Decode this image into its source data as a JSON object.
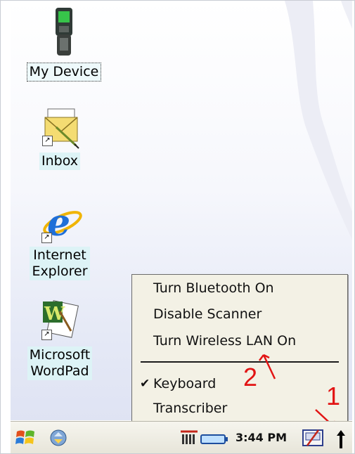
{
  "desktop": {
    "icons": [
      {
        "label": "My Device",
        "icon": "device-icon"
      },
      {
        "label": "Inbox",
        "icon": "inbox-icon"
      },
      {
        "label_line1": "Internet",
        "label_line2": "Explorer",
        "icon": "internet-explorer-icon"
      },
      {
        "label_line1": "Microsoft",
        "label_line2": "WordPad",
        "icon": "wordpad-icon"
      }
    ]
  },
  "popup_menu": {
    "items": [
      {
        "label": "Turn Bluetooth On"
      },
      {
        "label": "Disable Scanner"
      },
      {
        "label": "Turn Wireless LAN On"
      },
      {
        "label": "Keyboard",
        "checked": true
      },
      {
        "label": "Transcriber"
      }
    ]
  },
  "taskbar": {
    "time": "3:44 PM",
    "icons": [
      "start-icon",
      "activesync-icon",
      "signal-icon",
      "battery-icon",
      "keyboard-icon",
      "input-menu-arrow-icon"
    ]
  },
  "annotations": {
    "marker_1": "1",
    "marker_2": "2"
  },
  "colors": {
    "annotation": "#e21414",
    "menu_background": "#f3f1e5",
    "label_background": "#ddf3f6"
  }
}
